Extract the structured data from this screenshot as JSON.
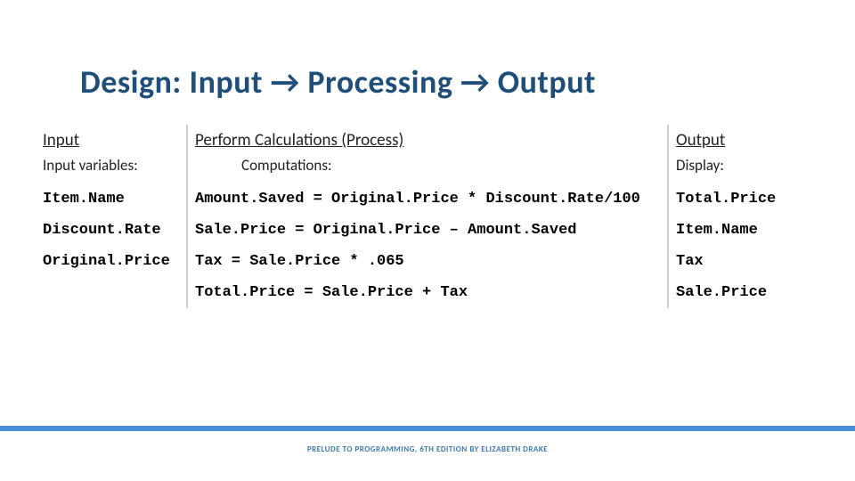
{
  "title": "Design: Input → Processing → Output",
  "headers": {
    "input": "Input",
    "process": "Perform Calculations (Process)",
    "output": "Output"
  },
  "subheaders": {
    "input": "Input variables:",
    "process": "Computations:",
    "output": "Display:"
  },
  "rows": [
    {
      "input": "Item.Name",
      "process": "Amount.Saved = Original.Price * Discount.Rate/100",
      "output": "Total.Price"
    },
    {
      "input": "Discount.Rate",
      "process": "Sale.Price = Original.Price – Amount.Saved",
      "output": "Item.Name"
    },
    {
      "input": "Original.Price",
      "process": "Tax = Sale.Price * .065",
      "output": "Tax"
    },
    {
      "input": "",
      "process": "Total.Price = Sale.Price + Tax",
      "output": "Sale.Price"
    }
  ],
  "footer": "PRELUDE TO PROGRAMMING, 6TH EDITION BY ELIZABETH DRAKE"
}
